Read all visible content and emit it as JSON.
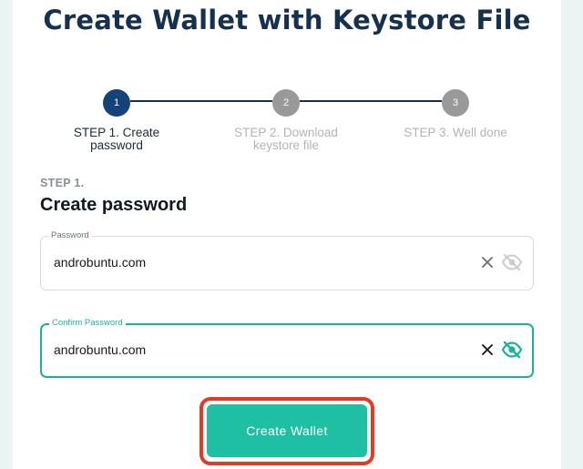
{
  "page": {
    "title": "Create Wallet with Keystore File"
  },
  "stepper": {
    "steps": [
      {
        "number": "1",
        "label": "STEP 1. Create password",
        "state": "active"
      },
      {
        "number": "2",
        "label": "STEP 2. Download keystore file",
        "state": "inactive"
      },
      {
        "number": "3",
        "label": "STEP 3. Well done",
        "state": "inactive"
      }
    ]
  },
  "form": {
    "step_kicker": "STEP 1.",
    "section_title": "Create password",
    "password": {
      "label": "Password",
      "value": "androbuntu.com"
    },
    "confirm_password": {
      "label": "Confirm Password",
      "value": "androbuntu.com"
    },
    "submit_label": "Create Wallet"
  },
  "colors": {
    "brand_navy": "#16304f",
    "accent_teal": "#1fbfa3",
    "highlight_red": "#e33b23"
  }
}
